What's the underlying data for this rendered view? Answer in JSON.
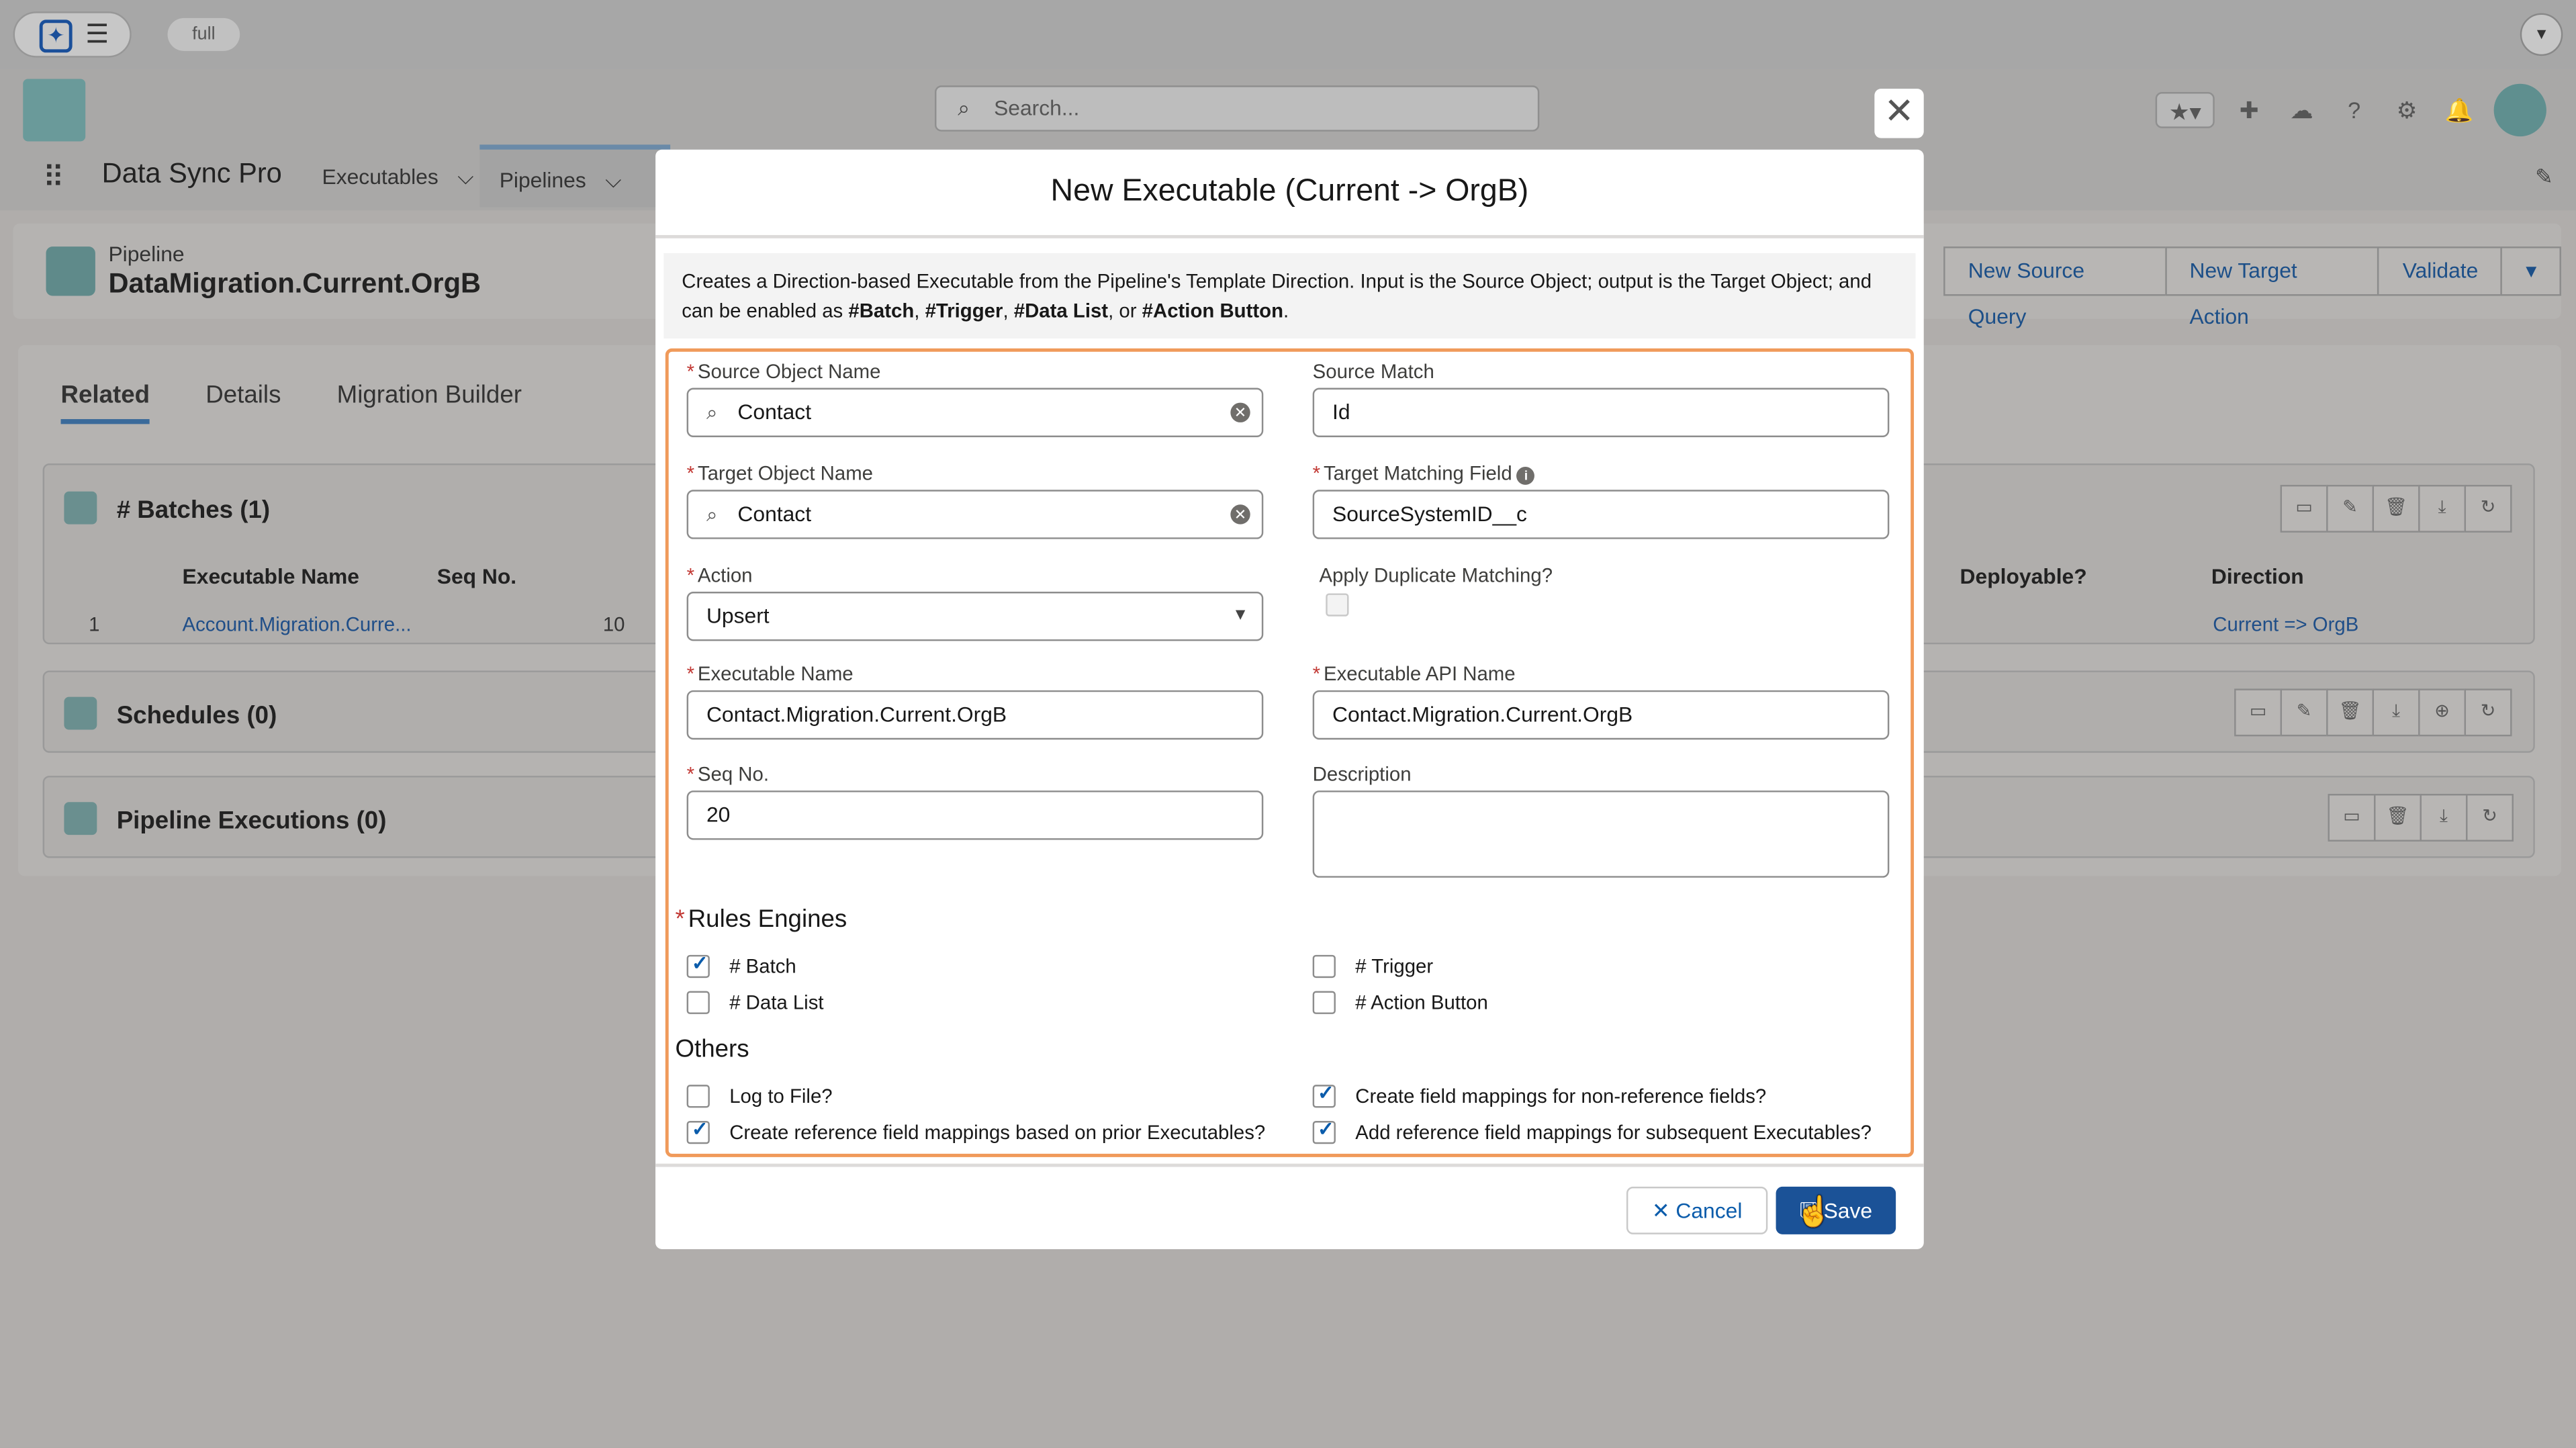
{
  "top": {
    "env_label": "full",
    "launcher_icon": "star-icon",
    "menu_icon": "hamburger-icon"
  },
  "search": {
    "placeholder": "Search..."
  },
  "nav": {
    "app_name": "Data Sync Pro",
    "items": [
      "Executables",
      "Pipelines"
    ]
  },
  "record": {
    "type": "Pipeline",
    "name": "DataMigration.Current.OrgB",
    "actions": [
      "New Source Query",
      "New Target Action",
      "Validate"
    ]
  },
  "tabs": [
    "Related",
    "Details",
    "Migration Builder"
  ],
  "related": {
    "batches_title": "# Batches (1)",
    "batches_columns": [
      "Executable Name",
      "Seq No.",
      "Deployable?",
      "Direction"
    ],
    "batch_row": {
      "num": "1",
      "name": "Account.Migration.Curre...",
      "seq": "10",
      "direction": "Current => OrgB"
    },
    "schedules_title": "Schedules (0)",
    "executions_title": "Pipeline Executions (0)"
  },
  "modal": {
    "title": "New Executable (Current -> OrgB)",
    "desc_parts": {
      "intro": "Creates a Direction-based Executable from the Pipeline's Template Direction. Input is the Source Object; output is the Target Object; and can be enabled as ",
      "batch": "#Batch",
      "trigger": "#Trigger",
      "datalist": "#Data List",
      "or": ", or ",
      "action": "#Action Button",
      "end": "."
    },
    "fields": {
      "source_object": {
        "label": "Source Object Name",
        "value": "Contact"
      },
      "source_match": {
        "label": "Source Match",
        "value": "Id"
      },
      "target_object": {
        "label": "Target Object Name",
        "value": "Contact"
      },
      "target_matching": {
        "label": "Target Matching Field",
        "value": "SourceSystemID__c"
      },
      "action": {
        "label": "Action",
        "value": "Upsert"
      },
      "apply_dup": {
        "label": "Apply Duplicate Matching?"
      },
      "exec_name": {
        "label": "Executable Name",
        "value": "Contact.Migration.Current.OrgB"
      },
      "exec_api": {
        "label": "Executable API Name",
        "value": "Contact.Migration.Current.OrgB"
      },
      "seq": {
        "label": "Seq No.",
        "value": "20"
      },
      "description": {
        "label": "Description",
        "value": ""
      }
    },
    "rules_title": "Rules Engines",
    "rules": [
      {
        "label": "# Batch",
        "checked": true
      },
      {
        "label": "# Trigger",
        "checked": false
      },
      {
        "label": "# Data List",
        "checked": false
      },
      {
        "label": "# Action Button",
        "checked": false
      }
    ],
    "others_title": "Others",
    "others": [
      {
        "label": "Log to File?",
        "checked": false
      },
      {
        "label": "Create field mappings for non-reference fields?",
        "checked": true
      },
      {
        "label": "Create reference field mappings based on prior Executables?",
        "checked": true
      },
      {
        "label": "Add reference field mappings for subsequent Executables?",
        "checked": true
      }
    ],
    "cancel_label": "Cancel",
    "save_label": "Save"
  },
  "colors": {
    "brand_blue": "#1b5297",
    "highlight_border": "#f09a5a",
    "link": "#0b5cab"
  }
}
